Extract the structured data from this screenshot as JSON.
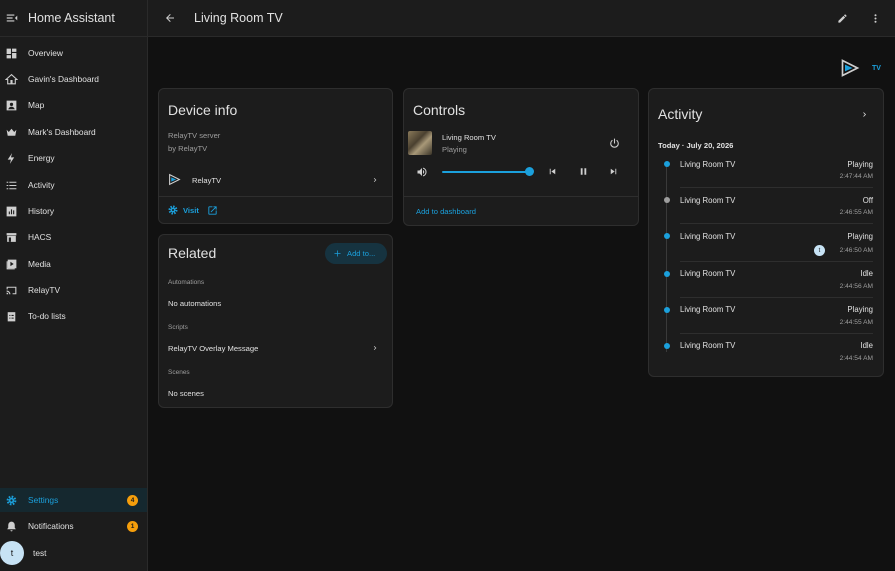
{
  "app": {
    "title": "Home Assistant"
  },
  "sidebar": {
    "items": [
      {
        "label": "Overview",
        "icon": "overview-icon"
      },
      {
        "label": "Gavin's Dashboard",
        "icon": "home-icon"
      },
      {
        "label": "Map",
        "icon": "map-icon"
      },
      {
        "label": "Mark's Dashboard",
        "icon": "crown-icon"
      },
      {
        "label": "Energy",
        "icon": "lightning-icon"
      },
      {
        "label": "Activity",
        "icon": "list-icon"
      },
      {
        "label": "History",
        "icon": "chart-icon"
      },
      {
        "label": "HACS",
        "icon": "store-icon"
      },
      {
        "label": "Media",
        "icon": "play-box-icon"
      },
      {
        "label": "RelayTV",
        "icon": "cast-icon"
      },
      {
        "label": "To-do lists",
        "icon": "clipboard-icon"
      }
    ],
    "settings": {
      "label": "Settings",
      "badge": "4"
    },
    "notifications": {
      "label": "Notifications",
      "badge": "1"
    },
    "user": {
      "initial": "t",
      "name": "test"
    }
  },
  "header": {
    "title": "Living Room TV"
  },
  "logo": {
    "text": "TV"
  },
  "device_info": {
    "title": "Device info",
    "model": "RelayTV server",
    "manufacturer": "by RelayTV",
    "integration": "RelayTV",
    "visit_label": "Visit"
  },
  "related": {
    "title": "Related",
    "add_label": "Add to...",
    "automations_header": "Automations",
    "automations_value": "No automations",
    "scripts_header": "Scripts",
    "script_item": "RelayTV Overlay Message",
    "scenes_header": "Scenes",
    "scenes_value": "No scenes"
  },
  "controls": {
    "title": "Controls",
    "media_name": "Living Room TV",
    "media_state": "Playing",
    "volume_level": 0.95,
    "add_to_dashboard": "Add to dashboard"
  },
  "activity": {
    "title": "Activity",
    "date_header": "Today · July 20, 2026",
    "entries": [
      {
        "name": "Living Room TV",
        "state": "Playing",
        "time": "2:47:44 AM"
      },
      {
        "name": "Living Room TV",
        "state": "Off",
        "time": "2:46:55 AM"
      },
      {
        "name": "Living Room TV",
        "state": "Playing",
        "time": "2:46:50 AM",
        "user": "t"
      },
      {
        "name": "Living Room TV",
        "state": "Idle",
        "time": "2:44:56 AM"
      },
      {
        "name": "Living Room TV",
        "state": "Playing",
        "time": "2:44:55 AM"
      },
      {
        "name": "Living Room TV",
        "state": "Idle",
        "time": "2:44:54 AM"
      }
    ]
  },
  "colors": {
    "accent": "#1ba0dc",
    "badge": "#f59e0b",
    "background": "#111111",
    "card": "#1c1c1c"
  }
}
